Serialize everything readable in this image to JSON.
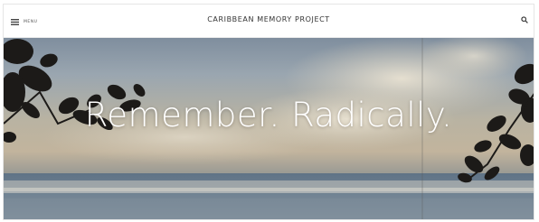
{
  "header": {
    "menu_label": "MENU",
    "site_title": "CARIBBEAN MEMORY PROJECT",
    "menu_icon": "hamburger-icon",
    "search_icon": "search-icon"
  },
  "hero": {
    "tagline": "Remember. Radically."
  },
  "colors": {
    "header_bg": "#ffffff",
    "title_text": "#333333",
    "tagline_text": "#ffffff"
  }
}
